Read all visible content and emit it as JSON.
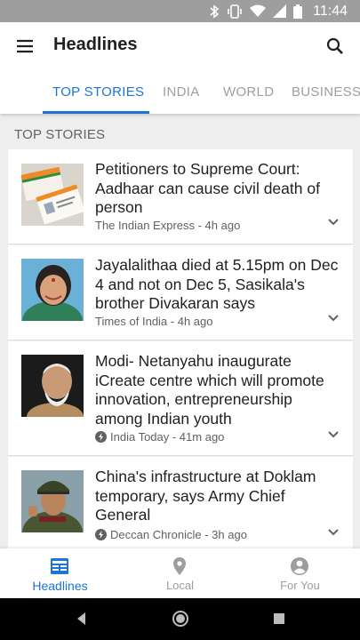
{
  "status_bar": {
    "time": "11:44",
    "icons": [
      "bluetooth-icon",
      "vibrate-icon",
      "wifi-icon",
      "cell-signal-icon",
      "battery-icon"
    ]
  },
  "app_bar": {
    "title": "Headlines",
    "menu_icon": "menu-icon",
    "search_icon": "search-icon"
  },
  "tabs": [
    {
      "label": "TOP STORIES",
      "active": true
    },
    {
      "label": "INDIA",
      "active": false
    },
    {
      "label": "WORLD",
      "active": false
    },
    {
      "label": "BUSINESS",
      "active": false
    }
  ],
  "section_title": "TOP STORIES",
  "stories": [
    {
      "headline": "Petitioners to Supreme Court: Aadhaar can cause civil death of person",
      "source": "The Indian Express - 4h ago",
      "amp": false,
      "thumbnail": "aadhaar-cards-image"
    },
    {
      "headline": "Jayalalithaa died at 5.15pm on Dec 4 and not on Dec 5, Sasikala's brother Divakaran says",
      "source": "Times of India - 4h ago",
      "amp": false,
      "thumbnail": "jayalalithaa-portrait-image"
    },
    {
      "headline": "Modi- Netanyahu inaugurate iCreate centre which will promote innovation, entrepreneurship among Indian youth",
      "source": "India Today - 41m ago",
      "amp": true,
      "thumbnail": "modi-portrait-image"
    },
    {
      "headline": "China's infrastructure at Doklam temporary, says Army Chief General",
      "source": "Deccan Chronicle - 3h ago",
      "amp": true,
      "thumbnail": "army-chief-image"
    }
  ],
  "bottom_nav": [
    {
      "label": "Headlines",
      "icon": "newspaper-icon",
      "active": true
    },
    {
      "label": "Local",
      "icon": "location-pin-icon",
      "active": false
    },
    {
      "label": "For You",
      "icon": "account-icon",
      "active": false
    }
  ],
  "colors": {
    "accent": "#1e74d4",
    "status_bar": "#9e9e9e",
    "background": "#eeeeee",
    "inactive": "#9e9e9e"
  }
}
